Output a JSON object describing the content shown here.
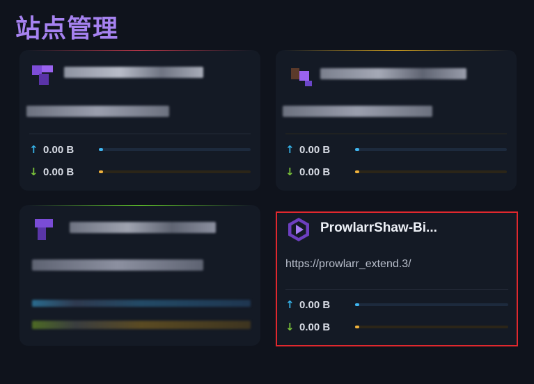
{
  "page": {
    "title": "站点管理"
  },
  "cards": [
    {
      "name": "",
      "url": "",
      "upload": "0.00 B",
      "download": "0.00 B",
      "upload_fraction": 0.02,
      "download_fraction": 0.02,
      "accent_color": "#c0384a",
      "blurred": true
    },
    {
      "name": "",
      "url": "",
      "upload": "0.00 B",
      "download": "0.00 B",
      "upload_fraction": 0.02,
      "download_fraction": 0.02,
      "accent_color": "#d0a020",
      "blurred": true
    },
    {
      "name": "",
      "url": "",
      "upload": "",
      "download": "",
      "accent_color": "#5fbf2a",
      "blurred": true
    },
    {
      "name": "ProwlarrShaw-Bi...",
      "url": "https://prowlarr_extend.3/",
      "upload": "0.00 B",
      "download": "0.00 B",
      "upload_fraction": 0.02,
      "download_fraction": 0.02,
      "icon": "prowlarr-logo-icon",
      "blurred": false
    }
  ],
  "icons": {
    "upload": "arrow-up-icon",
    "download": "arrow-down-icon"
  },
  "colors": {
    "title": "#a682f0",
    "upload_arrow": "#36b3e9",
    "download_arrow": "#7bc43a",
    "upload_bar": "#3fb6f0",
    "download_bar": "#f0b23c",
    "selection_outline": "#e0282e"
  }
}
